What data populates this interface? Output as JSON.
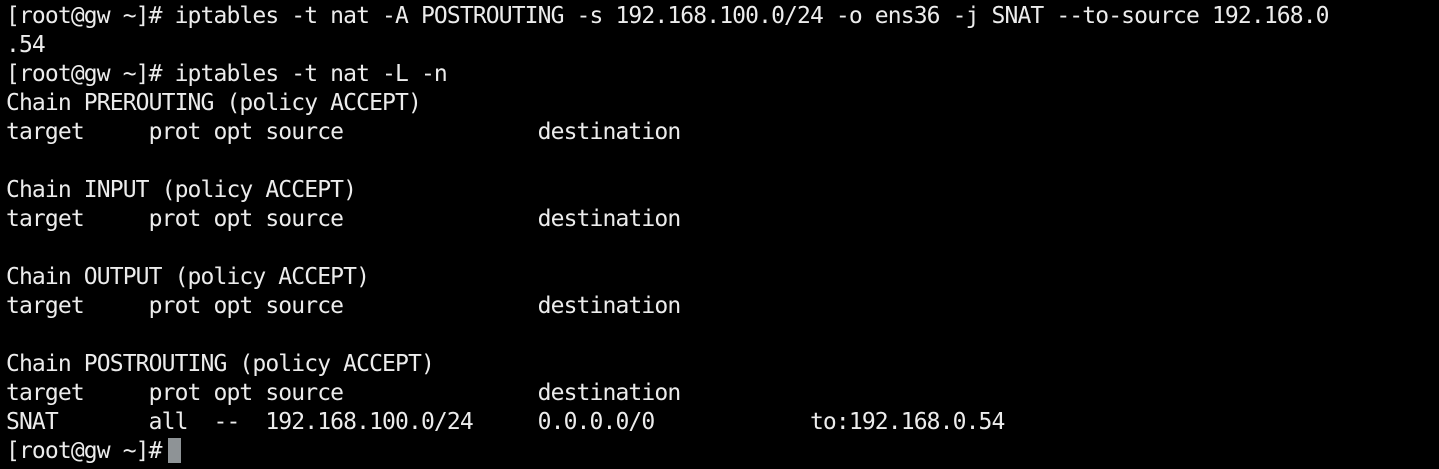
{
  "terminal": {
    "lines": [
      "[root@gw ~]# iptables -t nat -A POSTROUTING -s 192.168.100.0/24 -o ens36 -j SNAT --to-source 192.168.0",
      ".54",
      "[root@gw ~]# iptables -t nat -L -n",
      "Chain PREROUTING (policy ACCEPT)",
      "target     prot opt source               destination",
      "",
      "Chain INPUT (policy ACCEPT)",
      "target     prot opt source               destination",
      "",
      "Chain OUTPUT (policy ACCEPT)",
      "target     prot opt source               destination",
      "",
      "Chain POSTROUTING (policy ACCEPT)",
      "target     prot opt source               destination",
      "SNAT       all  --  192.168.100.0/24     0.0.0.0/0            to:192.168.0.54"
    ],
    "prompt": "[root@gw ~]#",
    "cursor_color": "#8e9396"
  }
}
